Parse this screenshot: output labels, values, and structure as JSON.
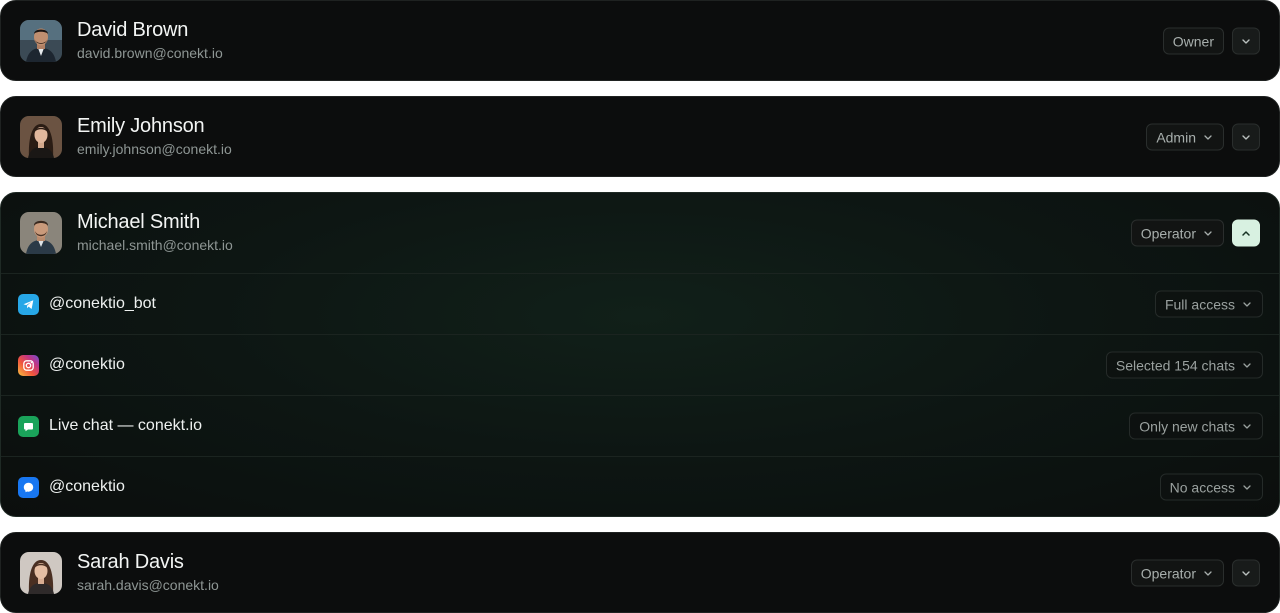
{
  "users": [
    {
      "name": "David Brown",
      "email": "david.brown@conekt.io",
      "role": "Owner",
      "role_has_menu": false,
      "expanded": false,
      "avatar_icon": "avatar-man-suit"
    },
    {
      "name": "Emily Johnson",
      "email": "emily.johnson@conekt.io",
      "role": "Admin",
      "role_has_menu": true,
      "expanded": false,
      "avatar_icon": "avatar-woman-dark-hair"
    },
    {
      "name": "Michael Smith",
      "email": "michael.smith@conekt.io",
      "role": "Operator",
      "role_has_menu": true,
      "expanded": true,
      "avatar_icon": "avatar-man-beard"
    },
    {
      "name": "Sarah Davis",
      "email": "sarah.davis@conekt.io",
      "role": "Operator",
      "role_has_menu": true,
      "expanded": false,
      "avatar_icon": "avatar-woman-brown-hair"
    }
  ],
  "channels": [
    {
      "label": "@conektio_bot",
      "access": "Full access",
      "icon": "telegram-icon",
      "color": "#27a7e7"
    },
    {
      "label": "@conektio",
      "access": "Selected 154 chats",
      "icon": "instagram-icon",
      "color": "#e1306c"
    },
    {
      "label": "Live chat — conekt.io",
      "access": "Only new chats",
      "icon": "live-chat-icon",
      "color": "#1aa35a"
    },
    {
      "label": "@conektio",
      "access": "No access",
      "icon": "messenger-icon",
      "color": "#1877f2"
    }
  ],
  "colors": {
    "card_bg": "#0c0d0d",
    "expanded_accent": "#d8f1e1",
    "text_primary": "#f3f5f4",
    "text_secondary": "#8e9694"
  }
}
